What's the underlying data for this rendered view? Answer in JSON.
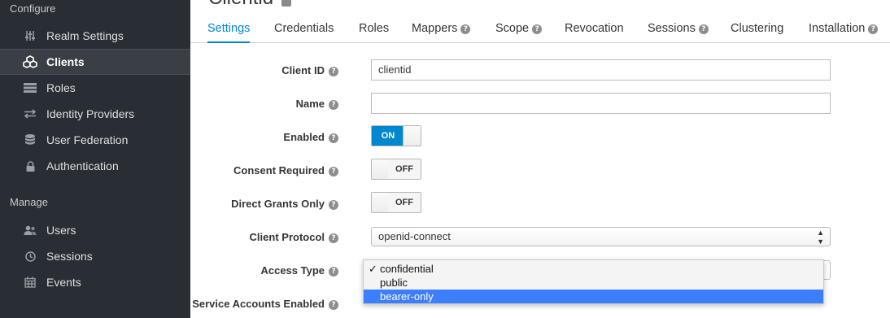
{
  "sidebar": {
    "configure_label": "Configure",
    "manage_label": "Manage",
    "configure_items": [
      {
        "label": "Realm Settings",
        "icon": "sliders-icon"
      },
      {
        "label": "Clients",
        "icon": "cubes-icon"
      },
      {
        "label": "Roles",
        "icon": "roles-icon"
      },
      {
        "label": "Identity Providers",
        "icon": "exchange-icon"
      },
      {
        "label": "User Federation",
        "icon": "database-icon"
      },
      {
        "label": "Authentication",
        "icon": "lock-icon"
      }
    ],
    "manage_items": [
      {
        "label": "Users",
        "icon": "users-icon"
      },
      {
        "label": "Sessions",
        "icon": "clock-icon"
      },
      {
        "label": "Events",
        "icon": "calendar-icon"
      }
    ]
  },
  "page": {
    "title": "Clientid"
  },
  "tabs": [
    {
      "label": "Settings",
      "help": false
    },
    {
      "label": "Credentials",
      "help": false
    },
    {
      "label": "Roles",
      "help": false
    },
    {
      "label": "Mappers",
      "help": true
    },
    {
      "label": "Scope",
      "help": true
    },
    {
      "label": "Revocation",
      "help": false
    },
    {
      "label": "Sessions",
      "help": true
    },
    {
      "label": "Clustering",
      "help": false
    },
    {
      "label": "Installation",
      "help": true
    }
  ],
  "form": {
    "client_id": {
      "label": "Client ID",
      "value": "clientid"
    },
    "name": {
      "label": "Name",
      "value": ""
    },
    "enabled": {
      "label": "Enabled",
      "state": "ON"
    },
    "consent_required": {
      "label": "Consent Required",
      "state": "OFF"
    },
    "direct_grants_only": {
      "label": "Direct Grants Only",
      "state": "OFF"
    },
    "client_protocol": {
      "label": "Client Protocol",
      "value": "openid-connect"
    },
    "access_type": {
      "label": "Access Type",
      "options": [
        "confidential",
        "public",
        "bearer-only"
      ],
      "selected": "confidential",
      "highlighted": "bearer-only"
    },
    "service_accounts_enabled": {
      "label": "Service Accounts Enabled"
    }
  },
  "help_glyph": "?",
  "check_glyph": "✓",
  "colors": {
    "accent": "#0088ce",
    "sidebar_bg": "#292e34",
    "dropdown_highlight": "#3d7eff"
  }
}
